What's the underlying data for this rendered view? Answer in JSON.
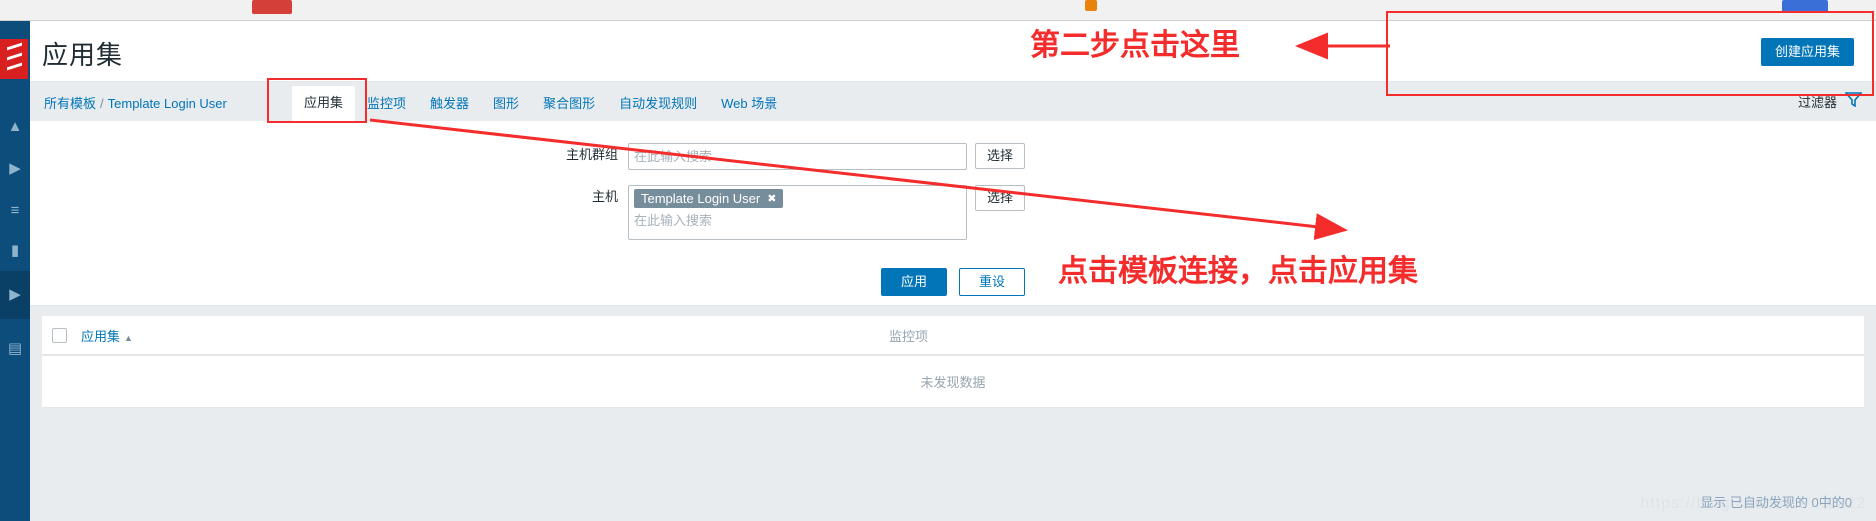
{
  "browser": {
    "tabs": [
      "chrome-tab-red",
      "chrome-tab-orange",
      "chrome-tab-blue"
    ]
  },
  "sidebar": {
    "logo": "zabbix-logo",
    "icons": [
      {
        "name": "chevron-up-icon",
        "glyph": "▲"
      },
      {
        "name": "chevron-right-icon",
        "glyph": "▶"
      },
      {
        "name": "menu-lines-icon",
        "glyph": "≡"
      },
      {
        "name": "monitor-icon",
        "glyph": "▮"
      },
      {
        "name": "chevron-right-active-icon",
        "glyph": "▶"
      },
      {
        "name": "server-icon",
        "glyph": "▤"
      }
    ]
  },
  "header": {
    "title": "应用集",
    "create_button": "创建应用集"
  },
  "navigation": {
    "breadcrumb": {
      "all_templates": "所有模板",
      "separator": "/",
      "current": "Template Login User"
    },
    "tabs": [
      {
        "label": "应用集",
        "active": true
      },
      {
        "label": "监控项",
        "active": false
      },
      {
        "label": "触发器",
        "active": false
      },
      {
        "label": "图形",
        "active": false
      },
      {
        "label": "聚合图形",
        "active": false
      },
      {
        "label": "自动发现规则",
        "active": false
      },
      {
        "label": "Web 场景",
        "active": false
      }
    ],
    "filter_toggle": "过滤器"
  },
  "filter": {
    "hostgroup": {
      "label": "主机群组",
      "placeholder": "在此输入搜索",
      "value": "",
      "select_button": "选择"
    },
    "host": {
      "label": "主机",
      "placeholder": "在此输入搜索",
      "chip": "Template Login User",
      "chip_remove": "✖",
      "select_button": "选择"
    },
    "apply_button": "应用",
    "reset_button": "重设"
  },
  "table": {
    "columns": {
      "appset": "应用集",
      "sort_arrow": "▲",
      "items": "监控项"
    },
    "empty_message": "未发现数据",
    "footer": "显示 已自动发现的 0中的0",
    "watermark": "https://blog.csdn.net/...0222"
  },
  "annotations": {
    "step2": "第二步点击这里",
    "step1": "点击模板连接，点击应用集",
    "color": "#f42c2c"
  },
  "colors": {
    "accent": "#0275b8",
    "sidebar": "#0c4d7c",
    "logo_red": "#d82020",
    "chip": "#768d9c",
    "panel_bg": "#e8ecef",
    "annotation": "#f42c2c"
  }
}
